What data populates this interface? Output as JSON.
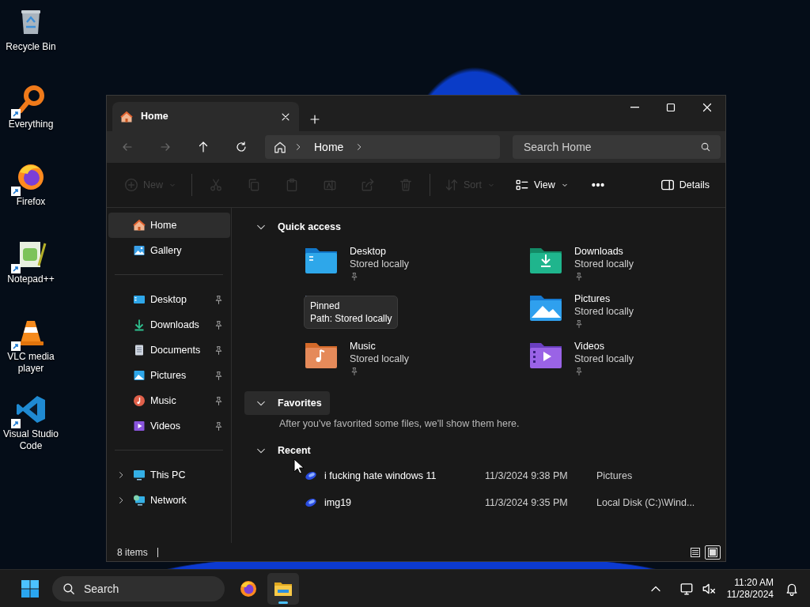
{
  "desktop_icons": [
    {
      "label": "Recycle Bin",
      "kind": "bin",
      "shortcut": false
    },
    {
      "label": "Everything",
      "kind": "magnifier",
      "shortcut": true
    },
    {
      "label": "Firefox",
      "kind": "browser",
      "shortcut": true
    },
    {
      "label": "Notepad++",
      "kind": "notepad",
      "shortcut": true
    },
    {
      "label": "VLC media player",
      "kind": "cone",
      "shortcut": true
    },
    {
      "label": "Visual Studio Code",
      "kind": "code",
      "shortcut": true
    }
  ],
  "window": {
    "tabs": [
      {
        "label": "Home",
        "selected": true
      }
    ],
    "address": {
      "path": [
        "Home"
      ]
    },
    "search": {
      "placeholder": "Search Home"
    },
    "toolbar": [
      {
        "kind": "new",
        "label": "New",
        "disabled": true
      },
      {
        "kind": "cut",
        "disabled": true
      },
      {
        "kind": "copy",
        "disabled": true
      },
      {
        "kind": "paste",
        "disabled": true
      },
      {
        "kind": "rename",
        "disabled": true
      },
      {
        "kind": "share",
        "disabled": true
      },
      {
        "kind": "delete",
        "disabled": true
      },
      {
        "kind": "sort",
        "label": "Sort",
        "disabled": true
      },
      {
        "kind": "view",
        "label": "View",
        "disabled": false
      },
      {
        "kind": "more",
        "disabled": false
      }
    ],
    "details": {
      "label": "Details"
    },
    "sidebar": {
      "top": [
        {
          "label": "Home",
          "kind": "home",
          "selected": true
        },
        {
          "label": "Gallery",
          "kind": "gallery",
          "selected": false
        }
      ],
      "pinned": [
        {
          "label": "Desktop",
          "kind": "desktop",
          "selected": false,
          "pinned": true
        },
        {
          "label": "Downloads",
          "kind": "downloads",
          "selected": false,
          "pinned": true
        },
        {
          "label": "Documents",
          "kind": "documents",
          "selected": false,
          "pinned": true
        },
        {
          "label": "Pictures",
          "kind": "pictures",
          "selected": false,
          "pinned": true
        },
        {
          "label": "Music",
          "kind": "music",
          "selected": false,
          "pinned": true
        },
        {
          "label": "Videos",
          "kind": "videos",
          "selected": false,
          "pinned": true
        }
      ],
      "locations": [
        {
          "label": "This PC",
          "kind": "pc",
          "expanded": false,
          "selected": false
        },
        {
          "label": "Network",
          "kind": "network",
          "expanded": false,
          "selected": false
        }
      ]
    },
    "quick_access": {
      "title": "Quick access",
      "expanded": true,
      "hovered": false,
      "items": [
        {
          "name": "Desktop",
          "subtitle": "Stored locally",
          "kind": "desktop",
          "pinned": true
        },
        {
          "name": "Downloads",
          "subtitle": "Stored locally",
          "kind": "downloads",
          "pinned": true
        },
        {
          "kind": "covered"
        },
        {
          "name": "Pictures",
          "subtitle": "Stored locally",
          "kind": "pictures",
          "pinned": true
        },
        {
          "name": "Music",
          "subtitle": "Stored locally",
          "kind": "music",
          "pinned": true
        },
        {
          "name": "Videos",
          "subtitle": "Stored locally",
          "kind": "videos",
          "pinned": true
        }
      ]
    },
    "tooltip": {
      "lines": [
        "Pinned",
        "Path: Stored locally"
      ]
    },
    "favorites": {
      "title": "Favorites",
      "expanded": true,
      "hovered": true,
      "message": "After you've favorited some files, we'll show them here."
    },
    "recent": {
      "title": "Recent",
      "expanded": true,
      "hovered": false,
      "files": [
        {
          "name": "i fucking hate windows 11",
          "date": "11/3/2024 9:38 PM",
          "location": "Pictures"
        },
        {
          "name": "img19",
          "date": "11/3/2024 9:35 PM",
          "location": "Local Disk (C:)\\Wind..."
        }
      ]
    },
    "status_bar": {
      "count": "8 items",
      "view_modes": [
        {
          "kind": "details",
          "selected": false
        },
        {
          "kind": "tiles",
          "selected": true
        }
      ]
    }
  },
  "taskbar": {
    "search": {
      "placeholder": "Search"
    },
    "apps": [
      {
        "kind": "browser",
        "active": false
      },
      {
        "kind": "explorer",
        "active": true
      }
    ],
    "time": "11:20 AM",
    "date": "11/28/2024"
  }
}
